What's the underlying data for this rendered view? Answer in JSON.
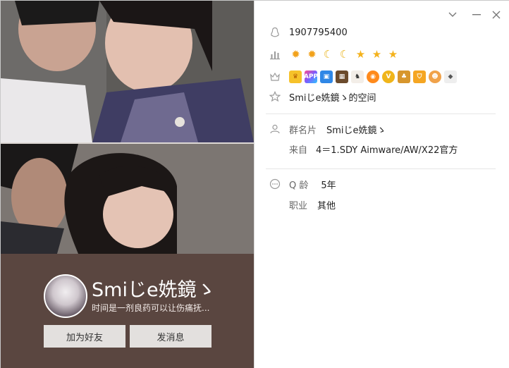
{
  "window": {
    "controls": {
      "collapse": "﹀",
      "minimize": "—",
      "close": "✕"
    }
  },
  "profile": {
    "nickname": "Smiじe姺鏡ゝ",
    "signature": "时间是一剂良药可以让伤痛抚...",
    "add_friend_label": "加为好友",
    "send_message_label": "发消息"
  },
  "info": {
    "qq_number": "1907795400",
    "level_icons": [
      "sun-icon",
      "sun-icon",
      "moon-icon",
      "moon-icon",
      "star-icon",
      "star-icon",
      "star-icon"
    ],
    "badge_icons": [
      "crown-badge-icon",
      "app-badge-icon",
      "photo-badge-icon",
      "game-badge-icon",
      "pet-badge-icon",
      "music-badge-icon",
      "vip-badge-icon",
      "game2-badge-icon",
      "shield-badge-icon",
      "monkey-badge-icon",
      "diamond-badge-icon"
    ],
    "qzone_label": "Smiじe姺鏡ゝ的空间",
    "group_card_label": "群名片",
    "group_card_value": "Smiじe姺鏡ゝ",
    "from_label": "来自",
    "from_value": "4＝1.SDY Aimware/AW/X22官方",
    "q_age_label": "Q 龄",
    "q_age_value": "5年",
    "job_label": "职业",
    "job_value": "其他"
  },
  "colors": {
    "left_bg": "#5a4640",
    "button_bg": "#e3e0de",
    "icon_gray": "#9a9a9a"
  }
}
